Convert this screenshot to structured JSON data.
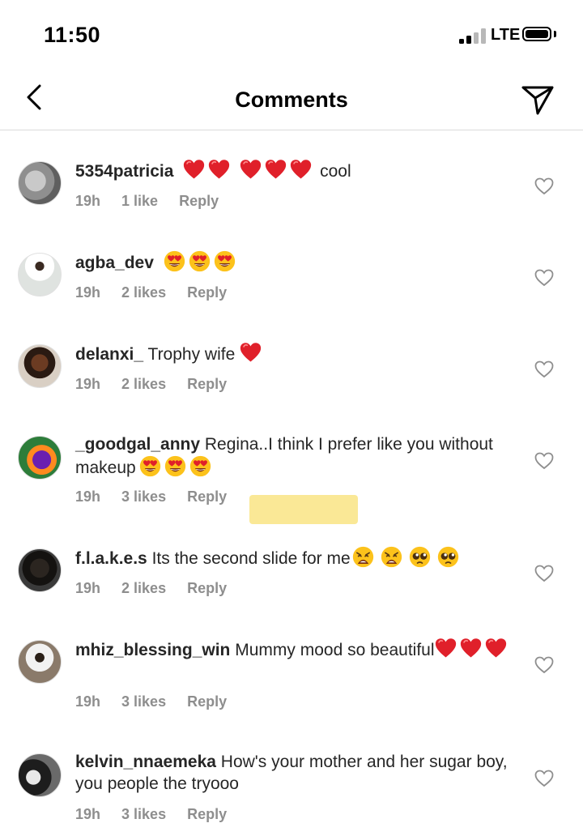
{
  "status_bar": {
    "time": "11:50",
    "network": "LTE"
  },
  "header": {
    "title": "Comments"
  },
  "comments": [
    {
      "user": "5354patricia",
      "text": " cool",
      "time": "19h",
      "likes": "1 like",
      "reply": "Reply"
    },
    {
      "user": "agba_dev",
      "text": "",
      "time": "19h",
      "likes": "2 likes",
      "reply": "Reply"
    },
    {
      "user": "delanxi_",
      "text": "Trophy wife",
      "time": "19h",
      "likes": "2 likes",
      "reply": "Reply"
    },
    {
      "user": "_goodgal_anny",
      "text": "Regina..I think I prefer like you without makeup",
      "time": "19h",
      "likes": "3 likes",
      "reply": "Reply"
    },
    {
      "user": "f.l.a.k.e.s",
      "text": "Its the second slide for me",
      "time": "19h",
      "likes": "2 likes",
      "reply": "Reply"
    },
    {
      "user": "mhiz_blessing_win",
      "text": "Mummy mood so beautiful",
      "time": "19h",
      "likes": "3 likes",
      "reply": "Reply"
    },
    {
      "user": "kelvin_nnaemeka",
      "text": "How's your mother and her sugar boy, you people the tryooo",
      "time": "19h",
      "likes": "3 likes",
      "reply": "Reply"
    }
  ],
  "colors": {
    "text": "#262626",
    "meta": "#8e8e8e",
    "divider": "#dbdbdb",
    "emoji_heart": "#e0202a",
    "highlight": "#f9e484"
  },
  "icons": [
    "back-icon",
    "send-icon",
    "like-heart-icon",
    "red-heart-emoji",
    "heart-eyes-emoji",
    "weary-face-emoji",
    "pleading-face-emoji"
  ]
}
